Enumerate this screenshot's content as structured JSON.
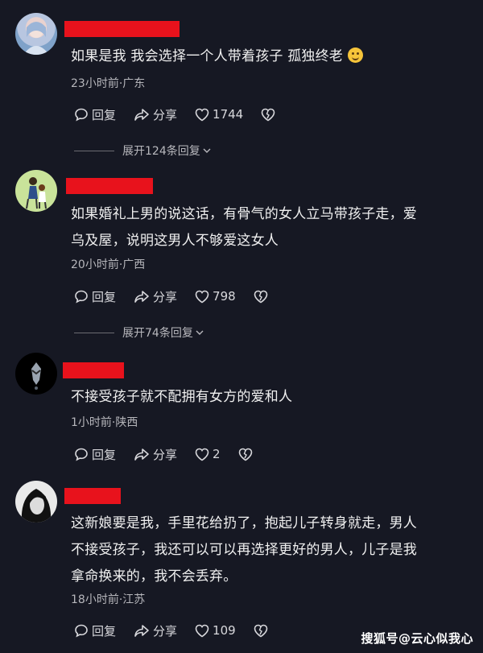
{
  "comments": [
    {
      "text": "如果是我 我会选择一个人带着孩子 孤独终老",
      "emoji": "smile-emoji",
      "meta": "23小时前·广东",
      "reply": "回复",
      "share": "分享",
      "likes": "1744",
      "expand": "展开124条回复"
    },
    {
      "text": "如果婚礼上男的说这话，有骨气的女人立马带孩子走，爱乌及屋，说明这男人不够爱这女人",
      "line1": "如果婚礼上男的说这话，有骨气的女人立马带孩子走，爱",
      "line2": "乌及屋，说明这男人不够爱这女人",
      "meta": "20小时前·广西",
      "reply": "回复",
      "share": "分享",
      "likes": "798",
      "expand": "展开74条回复"
    },
    {
      "text": "不接受孩子就不配拥有女方的爱和人",
      "meta": "1小时前·陕西",
      "reply": "回复",
      "share": "分享",
      "likes": "2"
    },
    {
      "line1": "这新娘要是我，手里花给扔了，抱起儿子转身就走，男人",
      "line2": "不接受孩子，我还可以可以再选择更好的男人，儿子是我",
      "line3": "拿命换来的，我不会丢弃。",
      "meta": "18小时前·江苏",
      "reply": "回复",
      "share": "分享",
      "likes": "109"
    }
  ],
  "watermark": "搜狐号@云心似我心",
  "colors": {
    "background": "#161823",
    "redacted_name": "#e8121c",
    "meta_text": "#b6b6bb"
  }
}
